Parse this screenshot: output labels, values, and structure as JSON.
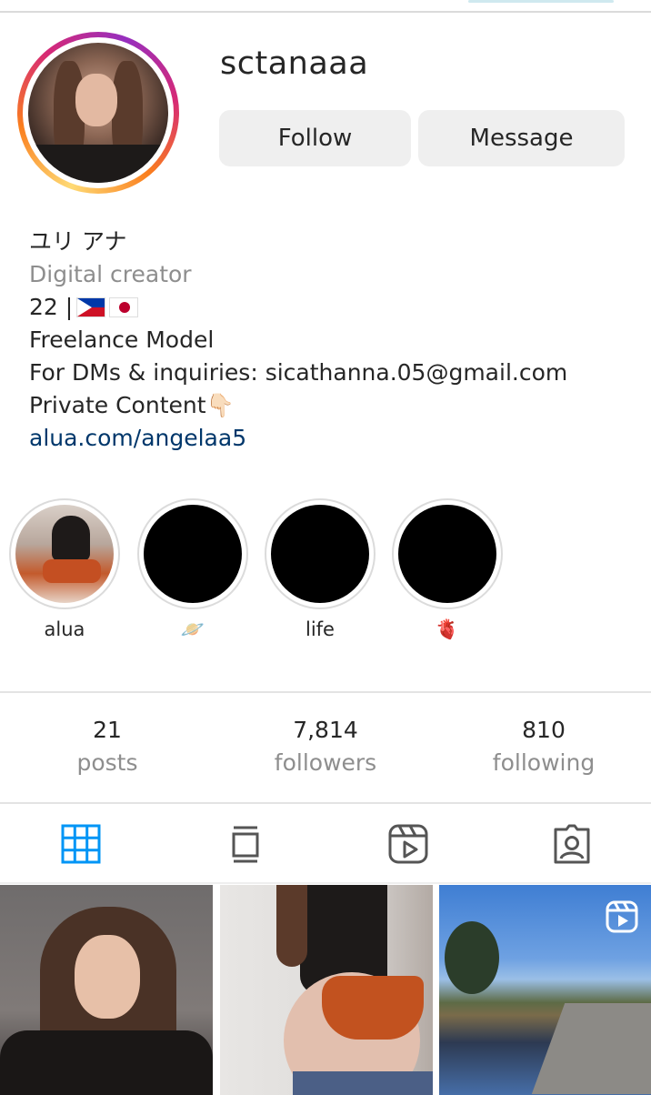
{
  "profile": {
    "username": "sctanaaa",
    "follow_label": "Follow",
    "message_label": "Message"
  },
  "bio": {
    "name": "ユリ アナ",
    "category": "Digital creator",
    "age_line": "22 |",
    "flags": [
      "philippines-flag",
      "japan-flag"
    ],
    "line_model": "Freelance Model",
    "line_dm": "For DMs & inquiries: sicathanna.05@gmail.com",
    "line_private": "Private Content",
    "private_emoji": "👇🏻",
    "link": "alua.com/angelaa5"
  },
  "highlights": [
    {
      "label": "alua"
    },
    {
      "label": "🪐"
    },
    {
      "label": "life"
    },
    {
      "label": "🫀"
    }
  ],
  "stats": {
    "posts": {
      "value": "21",
      "label": "posts"
    },
    "followers": {
      "value": "7,814",
      "label": "followers"
    },
    "following": {
      "value": "810",
      "label": "following"
    }
  },
  "tabs": [
    {
      "icon": "grid-icon",
      "active": true
    },
    {
      "icon": "feed-icon",
      "active": false
    },
    {
      "icon": "reels-icon",
      "active": false
    },
    {
      "icon": "tagged-icon",
      "active": false
    }
  ],
  "colors": {
    "active_tab": "#0095f6",
    "link": "#00376b",
    "secondary_text": "#8e8e8e",
    "button_bg": "#efefef"
  }
}
